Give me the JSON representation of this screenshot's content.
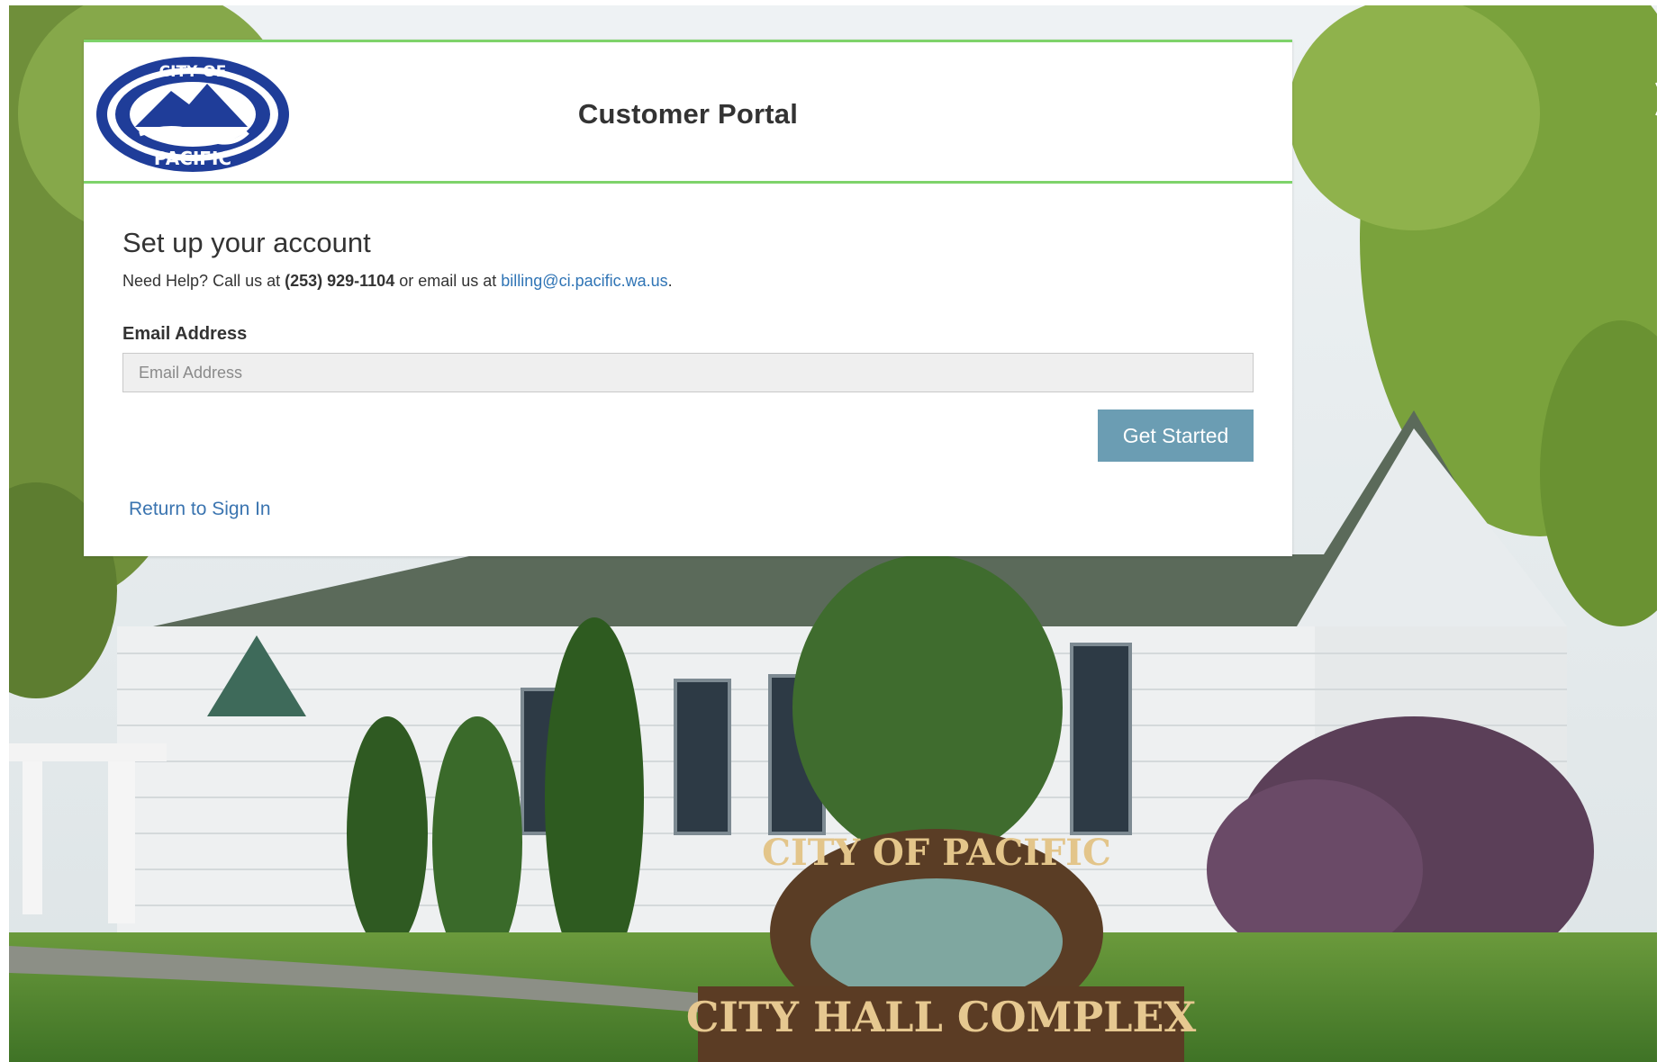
{
  "header": {
    "title": "Customer Portal",
    "logo_alt": "City of Pacific seal",
    "logo_text_top": "CITY OF",
    "logo_text_bottom": "PACIFIC"
  },
  "form": {
    "heading": "Set up your account",
    "help_prefix": "Need Help? Call us at ",
    "help_phone": "(253) 929-1104",
    "help_middle": " or email us at ",
    "help_email": "billing@ci.pacific.wa.us",
    "help_suffix": ".",
    "email_label": "Email Address",
    "email_placeholder": "Email Address",
    "email_value": "",
    "submit_label": "Get Started",
    "return_link": "Return to Sign In"
  },
  "background": {
    "sign_top": "CITY OF PACIFIC",
    "sign_bottom": "CITY HALL COMPLEX"
  },
  "colors": {
    "accent_green": "#7ed36a",
    "button": "#6b9db3",
    "link": "#2f74b5",
    "text": "#333333",
    "logo_blue": "#1f3d99"
  }
}
